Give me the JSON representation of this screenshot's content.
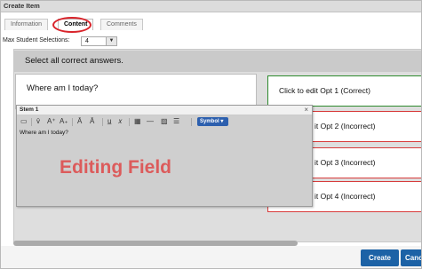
{
  "window": {
    "title": "Create Item"
  },
  "tabs": [
    {
      "label": "Information"
    },
    {
      "label": "Content"
    },
    {
      "label": "Comments"
    }
  ],
  "max_selections": {
    "label": "Max Student Selections:",
    "value": "4"
  },
  "instruction": "Select all correct answers.",
  "question": "Where am I today?",
  "options": [
    {
      "label": "Click to edit Opt 1 (Correct)",
      "status": "correct",
      "color": "#2d8a2d"
    },
    {
      "label": "it Opt 2 (Incorrect)",
      "status": "incorrect",
      "color": "#d83a3a"
    },
    {
      "label": "it Opt 3 (Incorrect)",
      "status": "incorrect",
      "color": "#d83a3a"
    },
    {
      "label": "it Opt 4 (Incorrect)",
      "status": "incorrect",
      "color": "#d83a3a"
    }
  ],
  "editor": {
    "title": "Stem 1",
    "close_glyph": "×",
    "symbol_label": "Symbol ▾",
    "text": "Where am I today?",
    "overlay_label": "Editing Field",
    "toolbar_icons": [
      "document-icon",
      "vector-icon",
      "superscript-icon",
      "subscript-icon",
      "overline-icon",
      "vector-arrow-icon",
      "underline-icon",
      "italic-icon",
      "table-icon",
      "line-icon",
      "image-icon",
      "list-icon"
    ]
  },
  "footer": {
    "create_label": "Create",
    "cancel_label": "Canc"
  },
  "colors": {
    "accent": "#1c62a6",
    "correct": "#2d8a2d",
    "incorrect": "#d83a3a",
    "highlight_ring": "#d9242b",
    "overlay_text": "#dc5b5b"
  }
}
